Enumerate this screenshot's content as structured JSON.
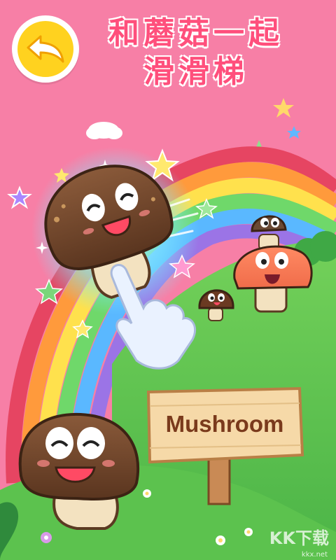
{
  "title": {
    "line1": "和蘑菇一起",
    "line2": "滑滑梯"
  },
  "back_button": {
    "icon": "back-arrow-icon"
  },
  "sign": {
    "word": "Mushroom"
  },
  "watermark": {
    "text": "KK下载",
    "url": "kkx.net"
  },
  "colors": {
    "background": "#f77fa6",
    "title": "#ff4f7c",
    "grass": "#5cc24e",
    "back_button": "#ffd21f"
  }
}
